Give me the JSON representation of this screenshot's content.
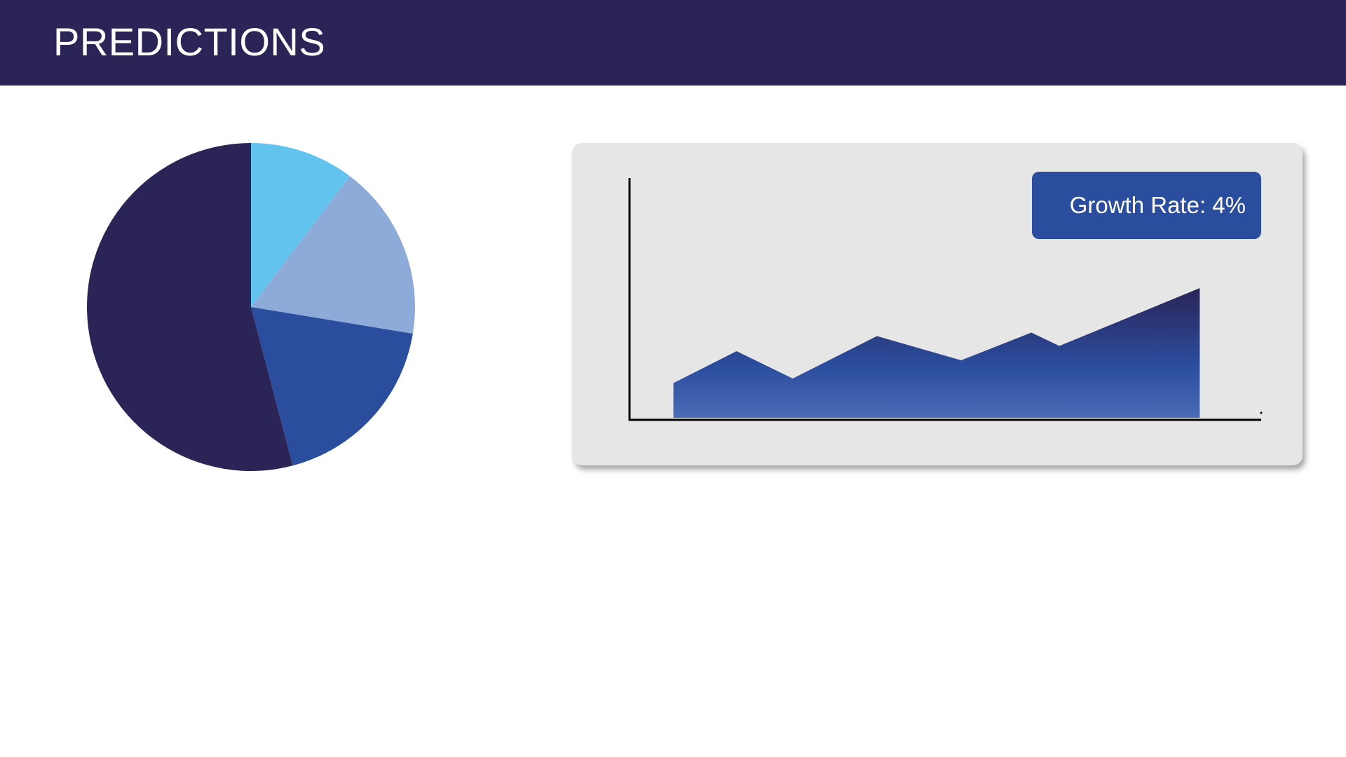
{
  "header": {
    "title": "PREDICTIONS"
  },
  "colors": {
    "header_bg": "#2a2457",
    "card_bg": "#e6e6e6",
    "badge_bg": "#2b4d9e",
    "area_top": "#2a2457",
    "area_mid": "#2b4d9e",
    "area_bottom": "#4a6bb5"
  },
  "chart_data": [
    {
      "type": "pie",
      "slices": [
        {
          "value": 10.3,
          "color": "#63c3ef"
        },
        {
          "value": 17.3,
          "color": "#8eaad8"
        },
        {
          "value": 18.3,
          "color": "#2b4d9e"
        },
        {
          "value": 54.1,
          "color": "#2a2457"
        }
      ]
    },
    {
      "type": "area",
      "x": [
        0,
        1.8,
        3.4,
        5.8,
        8.2,
        10.2,
        11.0,
        15.0
      ],
      "values": [
        10.5,
        19.6,
        11.8,
        23.9,
        17.0,
        24.9,
        21.1,
        37.6
      ],
      "xlim": [
        -1.25,
        16.75
      ],
      "ylim": [
        0,
        69
      ],
      "grid": false,
      "annotation": "Growth Rate: 4%"
    }
  ]
}
